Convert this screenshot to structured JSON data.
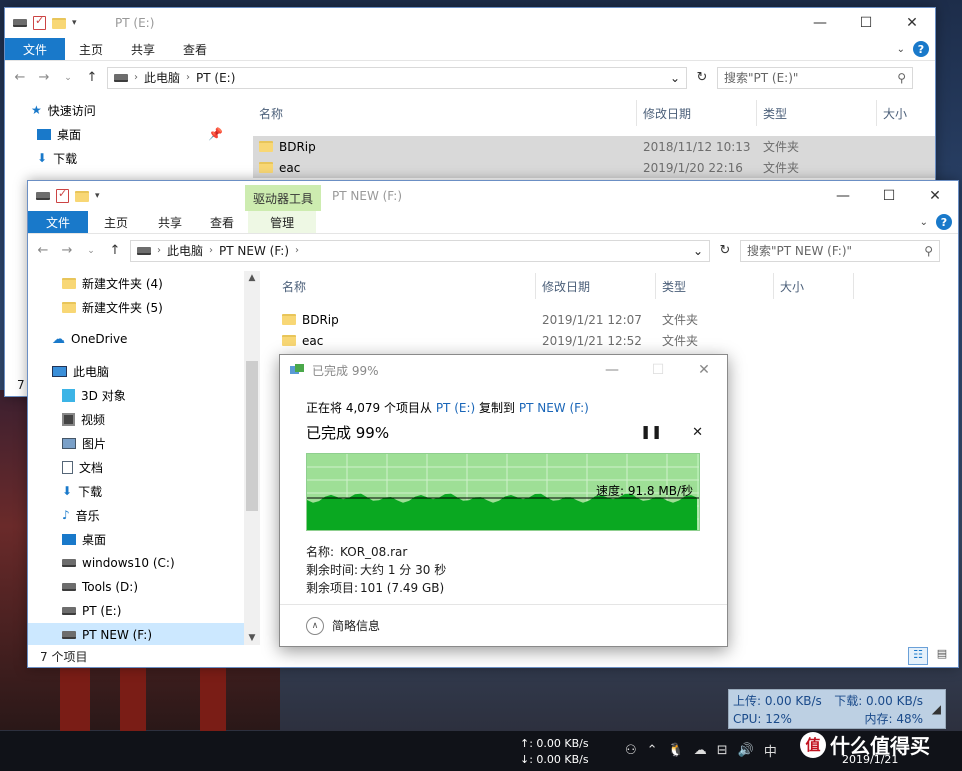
{
  "back_window": {
    "title": "PT (E:)",
    "tabs": [
      "文件",
      "主页",
      "共享",
      "查看"
    ],
    "breadcrumb": [
      "此电脑",
      "PT (E:)"
    ],
    "search_placeholder": "搜索\"PT (E:)\"",
    "columns": [
      "名称",
      "修改日期",
      "类型",
      "大小"
    ],
    "quick_access": "快速访问",
    "tree": [
      "桌面",
      "下载"
    ],
    "files": [
      {
        "name": "BDRip",
        "date": "2018/11/12 10:13",
        "type": "文件夹"
      },
      {
        "name": "eac",
        "date": "2019/1/20 22:16",
        "type": "文件夹"
      }
    ],
    "status_partial": "7"
  },
  "front_window": {
    "title": "PT NEW (F:)",
    "context_tab_group": "驱动器工具",
    "tabs": [
      "文件",
      "主页",
      "共享",
      "查看",
      "管理"
    ],
    "breadcrumb": [
      "此电脑",
      "PT NEW (F:)"
    ],
    "search_placeholder": "搜索\"PT NEW (F:)\"",
    "columns": [
      "名称",
      "修改日期",
      "类型",
      "大小"
    ],
    "tree": [
      {
        "label": "新建文件夹 (4)",
        "icon": "folder-icon"
      },
      {
        "label": "新建文件夹 (5)",
        "icon": "folder-icon"
      },
      {
        "label": "OneDrive",
        "icon": "cloud-icon"
      },
      {
        "label": "此电脑",
        "icon": "computer-icon"
      },
      {
        "label": "3D 对象",
        "icon": "cube-icon"
      },
      {
        "label": "视频",
        "icon": "video-icon"
      },
      {
        "label": "图片",
        "icon": "picture-icon"
      },
      {
        "label": "文档",
        "icon": "document-icon"
      },
      {
        "label": "下载",
        "icon": "download-icon"
      },
      {
        "label": "音乐",
        "icon": "music-icon"
      },
      {
        "label": "桌面",
        "icon": "desktop-icon"
      },
      {
        "label": "windows10 (C:)",
        "icon": "drive-icon"
      },
      {
        "label": "Tools (D:)",
        "icon": "drive-icon"
      },
      {
        "label": "PT (E:)",
        "icon": "drive-icon"
      },
      {
        "label": "PT NEW (F:)",
        "icon": "drive-icon"
      }
    ],
    "files": [
      {
        "name": "BDRip",
        "date": "2019/1/21 12:07",
        "type": "文件夹"
      },
      {
        "name": "eac",
        "date": "2019/1/21 12:52",
        "type": "文件夹"
      }
    ],
    "status": "7 个项目"
  },
  "copy_dialog": {
    "title": "已完成 99%",
    "line_prefix": "正在将 4,079 个项目从",
    "source": "PT (E:)",
    "line_mid": "复制到",
    "dest": "PT NEW (F:)",
    "percent_label": "已完成 99%",
    "progress_percent": 99,
    "speed_label": "速度: 91.8 MB/秒",
    "name_label": "名称:",
    "name_value": "KOR_08.rar",
    "time_label": "剩余时间:",
    "time_value": "大约 1 分 30 秒",
    "items_label": "剩余项目:",
    "items_value": "101 (7.49 GB)",
    "details_toggle": "简略信息",
    "accent": "#00b32c"
  },
  "monitor": {
    "upload": "上传: 0.00 KB/s",
    "download": "下载: 0.00 KB/s",
    "cpu": "CPU: 12%",
    "memory": "内存: 48%"
  },
  "taskbar": {
    "net_up": "↑: 0.00 KB/s",
    "net_down": "↓: 0.00 KB/s",
    "ime": "中",
    "date": "2019/1/21"
  },
  "watermark": {
    "badge": "值",
    "text": "什么值得买"
  }
}
